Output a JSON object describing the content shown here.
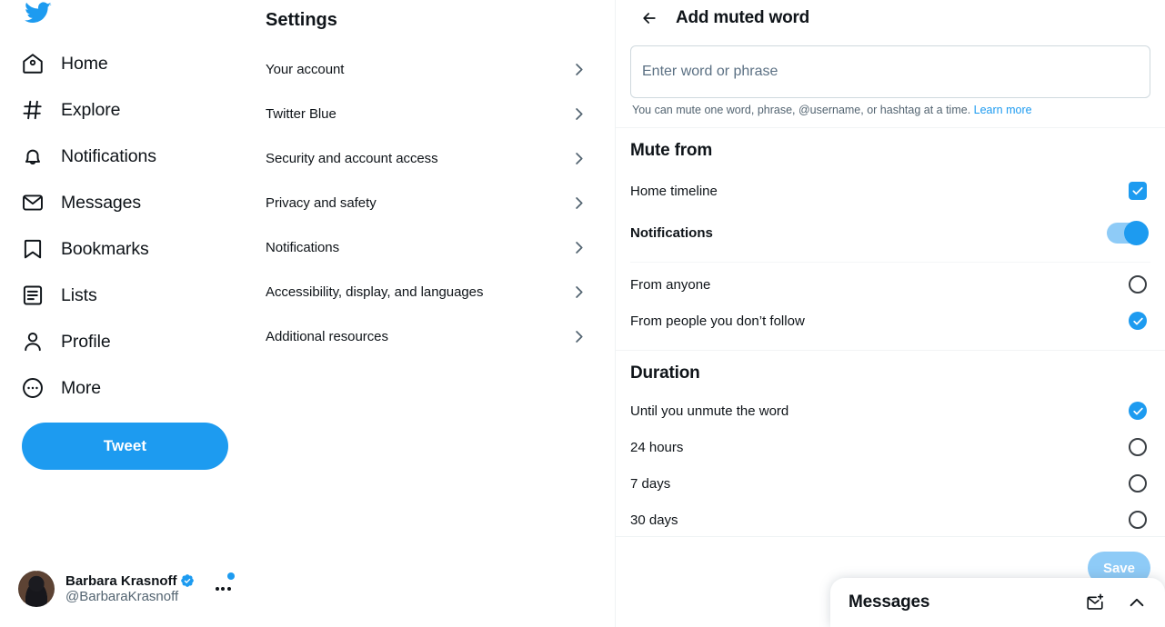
{
  "sidebar": {
    "logo_icon": "twitter-bird-icon",
    "items": [
      {
        "label": "Home",
        "icon": "home-icon"
      },
      {
        "label": "Explore",
        "icon": "hashtag-icon"
      },
      {
        "label": "Notifications",
        "icon": "bell-icon"
      },
      {
        "label": "Messages",
        "icon": "envelope-icon"
      },
      {
        "label": "Bookmarks",
        "icon": "bookmark-icon"
      },
      {
        "label": "Lists",
        "icon": "list-icon"
      },
      {
        "label": "Profile",
        "icon": "person-icon"
      },
      {
        "label": "More",
        "icon": "more-circle-icon"
      }
    ],
    "tweet_button": "Tweet",
    "account": {
      "name": "Barbara Krasnoff",
      "handle": "@BarbaraKrasnoff",
      "verified": true,
      "more_icon": "more-dots-icon"
    }
  },
  "settings": {
    "title": "Settings",
    "items": [
      {
        "label": "Your account"
      },
      {
        "label": "Twitter Blue"
      },
      {
        "label": "Security and account access"
      },
      {
        "label": "Privacy and safety"
      },
      {
        "label": "Notifications"
      },
      {
        "label": "Accessibility, display, and languages"
      },
      {
        "label": "Additional resources"
      }
    ],
    "chevron_icon": "chevron-right-icon"
  },
  "detail": {
    "back_icon": "arrow-left-icon",
    "title": "Add muted word",
    "input": {
      "placeholder": "Enter word or phrase",
      "value": ""
    },
    "helper_text": "You can mute one word, phrase, @username, or hashtag at a time.",
    "helper_link": "Learn more",
    "mute_from": {
      "title": "Mute from",
      "home_timeline": {
        "label": "Home timeline",
        "control": "checkbox",
        "checked": true
      },
      "notifications": {
        "label": "Notifications",
        "control": "toggle",
        "on": true
      },
      "options": [
        {
          "label": "From anyone",
          "selected": false
        },
        {
          "label": "From people you don’t follow",
          "selected": true
        }
      ]
    },
    "duration": {
      "title": "Duration",
      "options": [
        {
          "label": "Until you unmute the word",
          "selected": true
        },
        {
          "label": "24 hours",
          "selected": false
        },
        {
          "label": "7 days",
          "selected": false
        },
        {
          "label": "30 days",
          "selected": false
        }
      ]
    },
    "save_button": "Save"
  },
  "messages_dock": {
    "title": "Messages",
    "new_message_icon": "new-message-icon",
    "expand_icon": "chevron-up-icon"
  },
  "colors": {
    "accent": "#1d9bf0",
    "accent_disabled": "#8ecbf7",
    "text": "#0f1419",
    "muted_text": "#536471",
    "border": "#cfd9de",
    "divider": "#eff3f4"
  }
}
